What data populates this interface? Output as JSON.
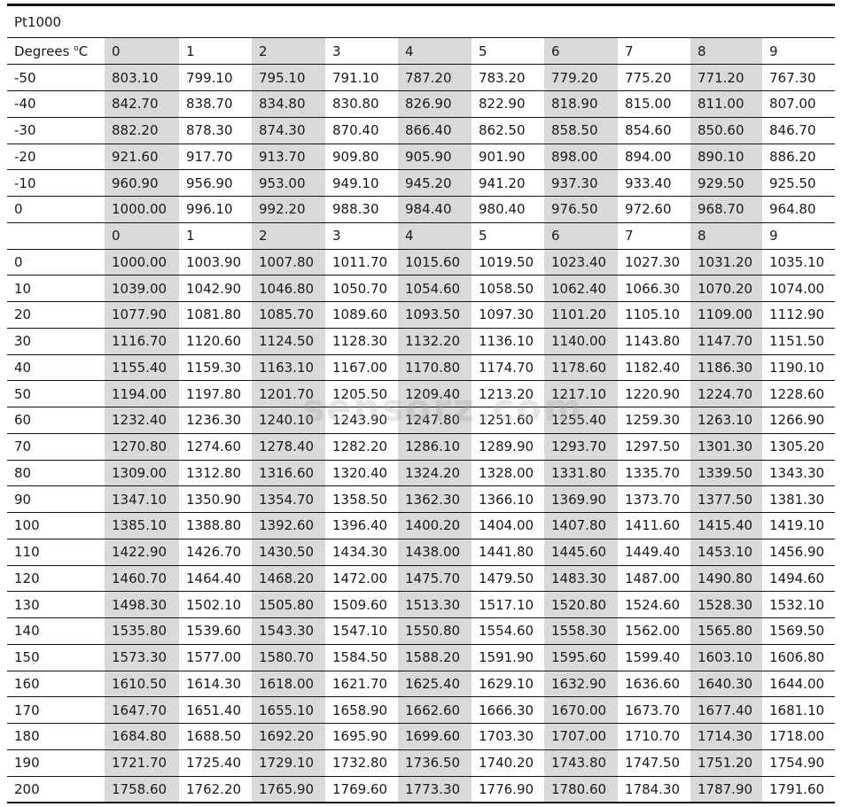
{
  "title": "Pt1000",
  "header": {
    "label_prefix": "Degrees ",
    "label_sup": "o",
    "label_unit": "C",
    "columns": [
      "0",
      "1",
      "2",
      "3",
      "4",
      "5",
      "6",
      "7",
      "8",
      "9"
    ]
  },
  "negative_rows": [
    {
      "label": "-50",
      "values": [
        "803.10",
        "799.10",
        "795.10",
        "791.10",
        "787.20",
        "783.20",
        "779.20",
        "775.20",
        "771.20",
        "767.30"
      ]
    },
    {
      "label": "-40",
      "values": [
        "842.70",
        "838.70",
        "834.80",
        "830.80",
        "826.90",
        "822.90",
        "818.90",
        "815.00",
        "811.00",
        "807.00"
      ]
    },
    {
      "label": "-30",
      "values": [
        "882.20",
        "878.30",
        "874.30",
        "870.40",
        "866.40",
        "862.50",
        "858.50",
        "854.60",
        "850.60",
        "846.70"
      ]
    },
    {
      "label": "-20",
      "values": [
        "921.60",
        "917.70",
        "913.70",
        "909.80",
        "905.90",
        "901.90",
        "898.00",
        "894.00",
        "890.10",
        "886.20"
      ]
    },
    {
      "label": "-10",
      "values": [
        "960.90",
        "956.90",
        "953.00",
        "949.10",
        "945.20",
        "941.20",
        "937.30",
        "933.40",
        "929.50",
        "925.50"
      ]
    },
    {
      "label": "0",
      "values": [
        "1000.00",
        "996.10",
        "992.20",
        "988.30",
        "984.40",
        "980.40",
        "976.50",
        "972.60",
        "968.70",
        "964.80"
      ]
    }
  ],
  "subheader": {
    "label": "",
    "columns": [
      "0",
      "1",
      "2",
      "3",
      "4",
      "5",
      "6",
      "7",
      "8",
      "9"
    ]
  },
  "positive_rows": [
    {
      "label": "0",
      "values": [
        "1000.00",
        "1003.90",
        "1007.80",
        "1011.70",
        "1015.60",
        "1019.50",
        "1023.40",
        "1027.30",
        "1031.20",
        "1035.10"
      ]
    },
    {
      "label": "10",
      "values": [
        "1039.00",
        "1042.90",
        "1046.80",
        "1050.70",
        "1054.60",
        "1058.50",
        "1062.40",
        "1066.30",
        "1070.20",
        "1074.00"
      ]
    },
    {
      "label": "20",
      "values": [
        "1077.90",
        "1081.80",
        "1085.70",
        "1089.60",
        "1093.50",
        "1097.30",
        "1101.20",
        "1105.10",
        "1109.00",
        "1112.90"
      ]
    },
    {
      "label": "30",
      "values": [
        "1116.70",
        "1120.60",
        "1124.50",
        "1128.30",
        "1132.20",
        "1136.10",
        "1140.00",
        "1143.80",
        "1147.70",
        "1151.50"
      ]
    },
    {
      "label": "40",
      "values": [
        "1155.40",
        "1159.30",
        "1163.10",
        "1167.00",
        "1170.80",
        "1174.70",
        "1178.60",
        "1182.40",
        "1186.30",
        "1190.10"
      ]
    },
    {
      "label": "50",
      "values": [
        "1194.00",
        "1197.80",
        "1201.70",
        "1205.50",
        "1209.40",
        "1213.20",
        "1217.10",
        "1220.90",
        "1224.70",
        "1228.60"
      ]
    },
    {
      "label": "60",
      "values": [
        "1232.40",
        "1236.30",
        "1240.10",
        "1243.90",
        "1247.80",
        "1251.60",
        "1255.40",
        "1259.30",
        "1263.10",
        "1266.90"
      ]
    },
    {
      "label": "70",
      "values": [
        "1270.80",
        "1274.60",
        "1278.40",
        "1282.20",
        "1286.10",
        "1289.90",
        "1293.70",
        "1297.50",
        "1301.30",
        "1305.20"
      ]
    },
    {
      "label": "80",
      "values": [
        "1309.00",
        "1312.80",
        "1316.60",
        "1320.40",
        "1324.20",
        "1328.00",
        "1331.80",
        "1335.70",
        "1339.50",
        "1343.30"
      ]
    },
    {
      "label": "90",
      "values": [
        "1347.10",
        "1350.90",
        "1354.70",
        "1358.50",
        "1362.30",
        "1366.10",
        "1369.90",
        "1373.70",
        "1377.50",
        "1381.30"
      ]
    },
    {
      "label": "100",
      "values": [
        "1385.10",
        "1388.80",
        "1392.60",
        "1396.40",
        "1400.20",
        "1404.00",
        "1407.80",
        "1411.60",
        "1415.40",
        "1419.10"
      ]
    },
    {
      "label": "110",
      "values": [
        "1422.90",
        "1426.70",
        "1430.50",
        "1434.30",
        "1438.00",
        "1441.80",
        "1445.60",
        "1449.40",
        "1453.10",
        "1456.90"
      ]
    },
    {
      "label": "120",
      "values": [
        "1460.70",
        "1464.40",
        "1468.20",
        "1472.00",
        "1475.70",
        "1479.50",
        "1483.30",
        "1487.00",
        "1490.80",
        "1494.60"
      ]
    },
    {
      "label": "130",
      "values": [
        "1498.30",
        "1502.10",
        "1505.80",
        "1509.60",
        "1513.30",
        "1517.10",
        "1520.80",
        "1524.60",
        "1528.30",
        "1532.10"
      ]
    },
    {
      "label": "140",
      "values": [
        "1535.80",
        "1539.60",
        "1543.30",
        "1547.10",
        "1550.80",
        "1554.60",
        "1558.30",
        "1562.00",
        "1565.80",
        "1569.50"
      ]
    },
    {
      "label": "150",
      "values": [
        "1573.30",
        "1577.00",
        "1580.70",
        "1584.50",
        "1588.20",
        "1591.90",
        "1595.60",
        "1599.40",
        "1603.10",
        "1606.80"
      ]
    },
    {
      "label": "160",
      "values": [
        "1610.50",
        "1614.30",
        "1618.00",
        "1621.70",
        "1625.40",
        "1629.10",
        "1632.90",
        "1636.60",
        "1640.30",
        "1644.00"
      ]
    },
    {
      "label": "170",
      "values": [
        "1647.70",
        "1651.40",
        "1655.10",
        "1658.90",
        "1662.60",
        "1666.30",
        "1670.00",
        "1673.70",
        "1677.40",
        "1681.10"
      ]
    },
    {
      "label": "180",
      "values": [
        "1684.80",
        "1688.50",
        "1692.20",
        "1695.90",
        "1699.60",
        "1703.30",
        "1707.00",
        "1710.70",
        "1714.30",
        "1718.00"
      ]
    },
    {
      "label": "190",
      "values": [
        "1721.70",
        "1725.40",
        "1729.10",
        "1732.80",
        "1736.50",
        "1740.20",
        "1743.80",
        "1747.50",
        "1751.20",
        "1754.90"
      ]
    },
    {
      "label": "200",
      "values": [
        "1758.60",
        "1762.20",
        "1765.90",
        "1769.60",
        "1773.30",
        "1776.90",
        "1780.60",
        "1784.30",
        "1787.90",
        "1791.60"
      ]
    }
  ],
  "watermark": "sensorz.com",
  "colors": {
    "shaded_column": "#d9d9d9",
    "rule": "#111111"
  }
}
